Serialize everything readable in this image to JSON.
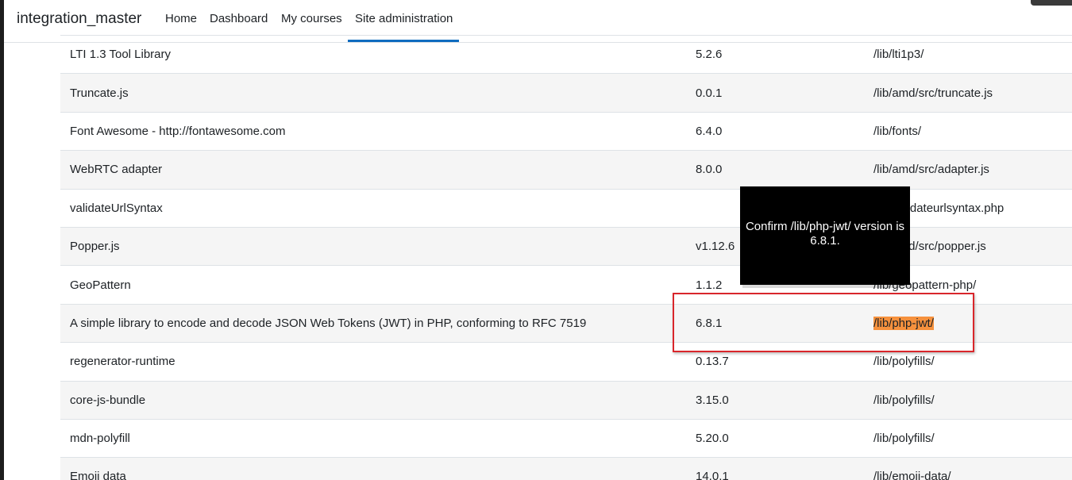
{
  "navbar": {
    "site_name": "integration_master",
    "links": [
      {
        "label": "Home"
      },
      {
        "label": "Dashboard"
      },
      {
        "label": "My courses"
      },
      {
        "label": "Site administration",
        "active": true
      }
    ]
  },
  "libraries": [
    {
      "name": "LTI 1.3 Tool Library",
      "version": "5.2.6",
      "location": "/lib/lti1p3/"
    },
    {
      "name": "Truncate.js",
      "version": "0.0.1",
      "location": "/lib/amd/src/truncate.js"
    },
    {
      "name": "Font Awesome - http://fontawesome.com",
      "version": "6.4.0",
      "location": "/lib/fonts/"
    },
    {
      "name": "WebRTC adapter",
      "version": "8.0.0",
      "location": "/lib/amd/src/adapter.js"
    },
    {
      "name": "validateUrlSyntax",
      "version": "",
      "location": "/lib/validateurlsyntax.php"
    },
    {
      "name": "Popper.js",
      "version": "v1.12.6",
      "location": "/lib/amd/src/popper.js"
    },
    {
      "name": "GeoPattern",
      "version": "1.1.2",
      "location": "/lib/geopattern-php/"
    },
    {
      "name": "A simple library to encode and decode JSON Web Tokens (JWT) in PHP, conforming to RFC 7519",
      "version": "6.8.1",
      "location": "/lib/php-jwt/"
    },
    {
      "name": "regenerator-runtime",
      "version": "0.13.7",
      "location": "/lib/polyfills/"
    },
    {
      "name": "core-js-bundle",
      "version": "3.15.0",
      "location": "/lib/polyfills/"
    },
    {
      "name": "mdn-polyfill",
      "version": "5.20.0",
      "location": "/lib/polyfills/"
    },
    {
      "name": "Emoji data",
      "version": "14.0.1",
      "location": "/lib/emoji-data/"
    }
  ],
  "tooltip": {
    "text": "Confirm /lib/php-jwt/ version is 6.8.1."
  },
  "colors": {
    "accent": "#0f6cbf",
    "highlight": "#f6913d",
    "annotation_border": "#d9262b"
  }
}
